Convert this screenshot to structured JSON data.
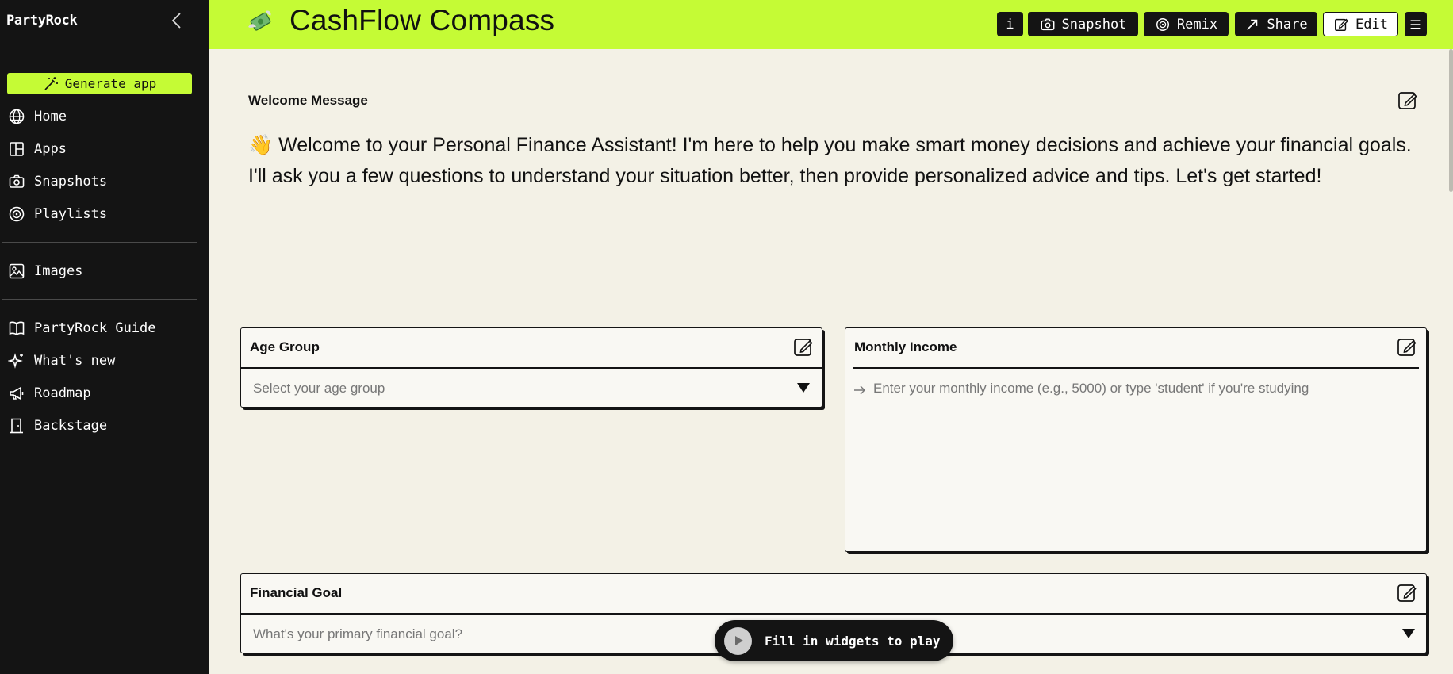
{
  "sidebar": {
    "brand": "PartyRock",
    "generate_label": "Generate app",
    "nav_main": [
      {
        "label": "Home",
        "icon": "globe-icon"
      },
      {
        "label": "Apps",
        "icon": "layout-icon"
      },
      {
        "label": "Snapshots",
        "icon": "camera-icon"
      },
      {
        "label": "Playlists",
        "icon": "playlist-icon"
      }
    ],
    "nav_media": [
      {
        "label": "Images",
        "icon": "image-icon"
      }
    ],
    "nav_help": [
      {
        "label": "PartyRock Guide",
        "icon": "book-icon"
      },
      {
        "label": "What's new",
        "icon": "sparkle-icon"
      },
      {
        "label": "Roadmap",
        "icon": "megaphone-icon"
      },
      {
        "label": "Backstage",
        "icon": "door-icon"
      }
    ]
  },
  "header": {
    "title": "CashFlow Compass",
    "icon": "money-with-wings-icon",
    "info_label": "i",
    "snapshot_label": "Snapshot",
    "remix_label": "Remix",
    "share_label": "Share",
    "edit_label": "Edit",
    "menu_icon": "hamburger-icon"
  },
  "welcome": {
    "label": "Welcome Message",
    "emoji": "👋",
    "text": "Welcome to your Personal Finance Assistant! I'm here to help you make smart money decisions and achieve your financial goals. I'll ask you a few questions to understand your situation better, then provide personalized advice and tips. Let's get started!"
  },
  "widgets": {
    "age_group": {
      "title": "Age Group",
      "placeholder": "Select your age group"
    },
    "monthly_income": {
      "title": "Monthly Income",
      "placeholder": "Enter your monthly income (e.g., 5000) or type 'student' if you're studying"
    },
    "financial_goal": {
      "title": "Financial Goal",
      "placeholder": "What's your primary financial goal?"
    }
  },
  "play": {
    "label": "Fill in widgets to play"
  },
  "colors": {
    "accent": "#c5fb35",
    "sidebar_bg": "#141414",
    "page_bg": "#f3f1e6"
  }
}
